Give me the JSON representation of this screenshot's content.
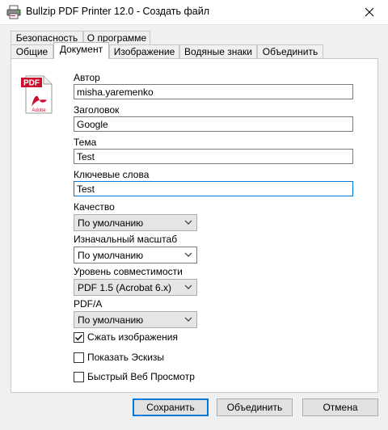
{
  "window": {
    "title": "Bullzip PDF Printer 12.0 - Создать файл",
    "close_glyph": "✕"
  },
  "tabs": {
    "row1": [
      {
        "label": "Безопасность"
      },
      {
        "label": "О программе"
      }
    ],
    "row2": [
      {
        "label": "Общие"
      },
      {
        "label": "Документ",
        "active": true
      },
      {
        "label": "Изображение"
      },
      {
        "label": "Водяные знаки"
      },
      {
        "label": "Объединить"
      }
    ]
  },
  "logo": {
    "text": "PDF",
    "badge": "Adobe"
  },
  "fields": {
    "author": {
      "label": "Автор",
      "value": "misha.yaremenko"
    },
    "title": {
      "label": "Заголовок",
      "value": "Google"
    },
    "subject": {
      "label": "Тема",
      "value": "Test"
    },
    "keywords": {
      "label": "Ключевые слова",
      "value": "Test"
    }
  },
  "selects": {
    "quality": {
      "label": "Качество",
      "value": "По умолчанию"
    },
    "initial_zoom": {
      "label": "Изначальный масштаб",
      "value": "По умолчанию"
    },
    "compatibility": {
      "label": "Уровень совместимости",
      "value": "PDF 1.5 (Acrobat 6.x)"
    },
    "pdfa": {
      "label": "PDF/A",
      "value": "По умолчанию"
    }
  },
  "checks": {
    "compress_images": {
      "label": "Сжать изображения",
      "checked": true
    },
    "show_thumbnails": {
      "label": "Показать Эскизы",
      "checked": false
    },
    "fast_web_view": {
      "label": "Быстрый Веб Просмотр",
      "checked": false
    }
  },
  "buttons": {
    "save": "Сохранить",
    "merge": "Объединить",
    "cancel": "Отмена"
  },
  "colors": {
    "accent": "#0078d7",
    "pdf_red": "#c8102e"
  }
}
